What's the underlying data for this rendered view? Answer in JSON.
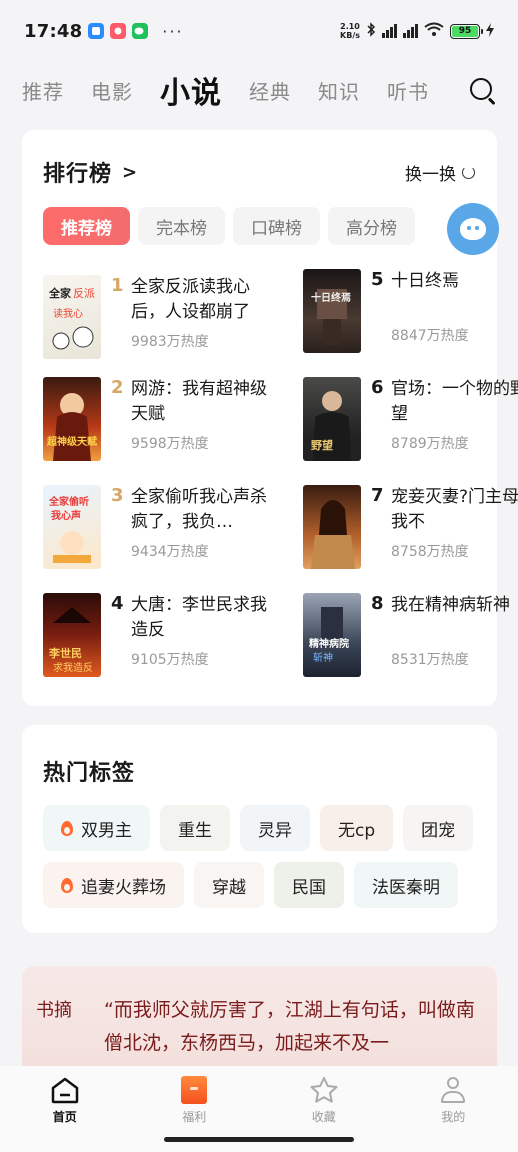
{
  "status_bar": {
    "time": "17:48",
    "dots": "···",
    "speed_value": "2.10",
    "speed_unit": "KB/s",
    "battery": "95"
  },
  "top_tabs": [
    "推荐",
    "电影",
    "小说",
    "经典",
    "知识",
    "听书"
  ],
  "active_tab": "小说",
  "ranking": {
    "title": "排行榜",
    "chevron": ">",
    "refresh_label": "换一换",
    "pills": [
      "推荐榜",
      "完本榜",
      "口碑榜",
      "高分榜"
    ],
    "books": [
      {
        "rank": "1",
        "name": "全家反派读我心后，人设都崩了",
        "heat": "9983万热度"
      },
      {
        "rank": "2",
        "name": "网游：我有超神级天赋",
        "heat": "9598万热度"
      },
      {
        "rank": "3",
        "name": "全家偷听我心声杀疯了，我负…",
        "heat": "9434万热度"
      },
      {
        "rank": "4",
        "name": "大唐：李世民求我造反",
        "heat": "9105万热度"
      },
      {
        "rank": "5",
        "name": "十日终焉",
        "heat": "8847万热度"
      },
      {
        "rank": "6",
        "name": "官场：一个物的野望",
        "heat": "8789万热度"
      },
      {
        "rank": "7",
        "name": "宠妾灭妻?门主母我不",
        "heat": "8758万热度"
      },
      {
        "rank": "8",
        "name": "我在精神病斩神",
        "heat": "8531万热度"
      }
    ]
  },
  "hot_tags": {
    "title": "热门标签",
    "row1": [
      "双男主",
      "重生",
      "灵异",
      "无cp",
      "团宠"
    ],
    "row2": [
      "追妻火葬场",
      "穿越",
      "民国",
      "法医秦明"
    ]
  },
  "excerpt": {
    "label": "书摘",
    "text": "“而我师父就厉害了，江湖上有句话，叫做南僧北沈，东杨西马，加起来不及一"
  },
  "bottom_nav": [
    {
      "label": "首页",
      "icon": "home-icon"
    },
    {
      "label": "福利",
      "icon": "gift-icon"
    },
    {
      "label": "收藏",
      "icon": "star-icon"
    },
    {
      "label": "我的",
      "icon": "person-icon"
    }
  ],
  "colors": {
    "accent": "#f46d6d",
    "rank_gold": "#d6a866",
    "excerpt_text": "#7a1c1c"
  }
}
